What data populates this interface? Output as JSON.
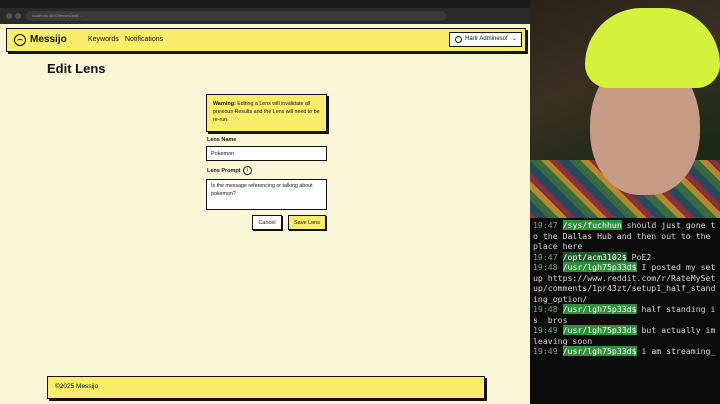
{
  "app": {
    "logo": "Messijo",
    "nav": [
      "Keywords",
      "Notifications"
    ],
    "user_menu": "Harlr Adminesof"
  },
  "browser": {
    "url": "localhost:4000/lenses/edit/…"
  },
  "page": {
    "title": "Edit Lens",
    "warning_bold": "Warning:",
    "warning_text": " Editing a Lens will invalidate all previous Results and the Lens will need to be re-run.",
    "lens_name_label": "Lens Name",
    "lens_name_value": "Pokemon",
    "lens_prompt_label": "Lens Prompt",
    "lens_prompt_value": "Is the message referencing or talking about pokemon?",
    "info_glyph": "i",
    "cancel_label": "Cancel",
    "save_label": "Save Lens"
  },
  "footer": {
    "text": "©2025 Messijo"
  },
  "chat": {
    "lines": [
      {
        "time": "19:47",
        "user": "/sys/fuchhun",
        "text": " should just gone to the Dallas Hub and then out to the place here",
        "alt": false
      },
      {
        "time": "19:47",
        "user": "/opt/acm3102$",
        "text": " PoE2",
        "alt": true
      },
      {
        "time": "19:48",
        "user": "/usr/lgh75p33d$",
        "text": " I posted my setup https://www.reddit.com/r/RateMySetup/comments/1pr43zt/setup1_half_standing_option/",
        "alt": false
      },
      {
        "time": "19:48",
        "user": "/usr/lgh75p33d$",
        "text": " half standing is  bros",
        "alt": false
      },
      {
        "time": "19:49",
        "user": "/usr/lgh75p33d$",
        "text": " but actually im leaving soon",
        "alt": false
      },
      {
        "time": "19:49",
        "user": "/usr/lgh75p33d$",
        "text": " i am streaming_",
        "alt": false
      }
    ]
  },
  "colors": {
    "accent_yellow": "#fbed6c",
    "page_bg": "#faf7d8",
    "chat_user": "#2f8f3a"
  }
}
